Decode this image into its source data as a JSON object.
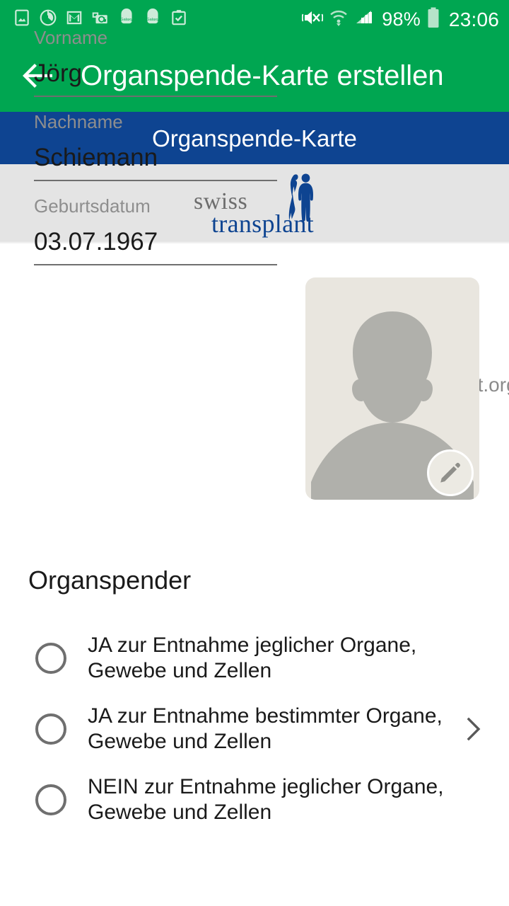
{
  "status_bar": {
    "left_icons": [
      "image-icon",
      "power-saving-icon",
      "gmail-icon",
      "email-at-icon",
      "galaxy-app-icon",
      "galaxy-app-icon-2",
      "clipboard-check-icon"
    ],
    "right_icons": [
      "mute-vibrate-icon",
      "wifi-icon",
      "signal-bars-icon",
      "battery-icon"
    ],
    "battery_percent": "98%",
    "clock": "23:06"
  },
  "app_bar": {
    "back_label": "←",
    "title": "Organspende-Karte erstellen",
    "background": "#00A651"
  },
  "blue_band": {
    "title": "Organspende-Karte",
    "background": "#0E4491"
  },
  "logo_band": {
    "brand_line1": "swiss",
    "brand_line2": "transplant",
    "site_url": "swisstransplant.org",
    "brand_color": "#0E4491",
    "brand_gray": "#6d6d6d",
    "background": "#e4e4e4"
  },
  "form": {
    "fields": [
      {
        "label": "Vorname",
        "value": "Jörg"
      },
      {
        "label": "Nachname",
        "value": "Schiemann"
      },
      {
        "label": "Geburtsdatum",
        "value": "03.07.1967"
      }
    ]
  },
  "avatar": {
    "name": "photo-placeholder",
    "edit_icon": "pencil-icon",
    "background": "#e9e6df",
    "silhouette_color": "#b0b0ab"
  },
  "organ_donor": {
    "section_title": "Organspender",
    "options": [
      {
        "label": "JA zur Entnahme jeglicher Organe, Gewebe und Zellen",
        "selected": false,
        "has_chevron": false
      },
      {
        "label": "JA zur Entnahme bestimmter Organe, Gewebe und Zellen",
        "selected": false,
        "has_chevron": true,
        "chevron_icon": "chevron-right-icon"
      },
      {
        "label": "NEIN zur Entnahme jeglicher Organe, Gewebe und Zellen",
        "selected": false,
        "has_chevron": false
      }
    ]
  }
}
